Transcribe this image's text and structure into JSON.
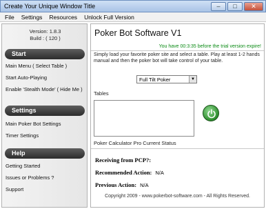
{
  "window": {
    "title": "Create Your Unique Window Title"
  },
  "menu": [
    "File",
    "Settings",
    "Resources",
    "Unlock Full Version"
  ],
  "sidebar": {
    "version": "Version: 1.8.3",
    "build": "Build : ( 120 )",
    "sections": [
      {
        "header": "Start",
        "items": [
          "Main Menu ( Select Table )",
          "Start Auto-Playing",
          "Enable 'Stealth Mode' ( Hide Me )"
        ]
      },
      {
        "header": "Settings",
        "items": [
          "Main Poker Bot Settings",
          "Timer Settings"
        ]
      },
      {
        "header": "Help",
        "items": [
          "Getting Started",
          "Issues or Problems ?",
          "Support"
        ]
      }
    ]
  },
  "main": {
    "title": "Poker Bot Software V1",
    "trial_notice": "You have 00:3:35 before the trial version expire!",
    "intro": "Simply load your favorite poker site and select a table. Play at least 1-2 hands manual and then the poker bot will take control of your table.",
    "site_select": "Full Tilt Poker",
    "tables_label": "Tables",
    "pcp_status_label": "Poker Calculator Pro Current Status",
    "receiving_label": "Receiving from PCP?:",
    "recommended_label": "Recommended Action:",
    "recommended_value": "N/A",
    "previous_label": "Previous Action:",
    "previous_value": "N/A",
    "copyright": "Copyright 2009 - www.pokerbot-software.com - All Rights Reserved."
  },
  "colors": {
    "trial_text": "#0a8a14",
    "section_header": "#3a3a3a",
    "go_button": "#2f8f2f"
  }
}
